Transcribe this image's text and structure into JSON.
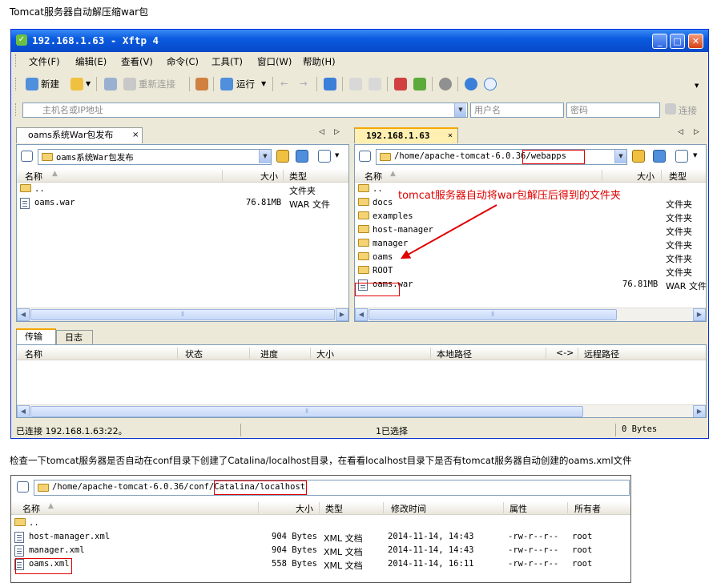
{
  "heading": "Tomcat服务器自动解压缩war包",
  "description": "检查一下tomcat服务器是否自动在conf目录下创建了Catalina/localhost目录，在看看localhost目录下是否有tomcat服务器自动创建的oams.xml文件",
  "window": {
    "title": "192.168.1.63 - Xftp 4",
    "menu": [
      "文件(F)",
      "编辑(E)",
      "查看(V)",
      "命令(C)",
      "工具(T)",
      "窗口(W)",
      "帮助(H)"
    ],
    "toolbar": {
      "new_label": "新建",
      "reconnect_label": "重新连接",
      "run_label": "运行"
    },
    "address": {
      "host_placeholder": "主机名或IP地址",
      "user_placeholder": "用户名",
      "password_placeholder": "密码",
      "connect_label": "连接"
    },
    "left_pane": {
      "tab": "oams系统War包发布",
      "path": "oams系统War包发布",
      "columns": {
        "name": "名称",
        "size": "大小",
        "type": "类型"
      },
      "rows": [
        {
          "name": "..",
          "size": "",
          "type": "文件夹",
          "kind": "folder"
        },
        {
          "name": "oams.war",
          "size": "76.81MB",
          "type": "WAR 文件",
          "kind": "file"
        }
      ]
    },
    "right_pane": {
      "tab": "192.168.1.63",
      "path_prefix": "/home/apache-tomcat-6.0.36/",
      "path_highlight": "webapps",
      "columns": {
        "name": "名称",
        "size": "大小",
        "type": "类型"
      },
      "rows": [
        {
          "name": "..",
          "size": "",
          "type": "",
          "kind": "folder"
        },
        {
          "name": "docs",
          "size": "",
          "type": "文件夹",
          "kind": "folder"
        },
        {
          "name": "examples",
          "size": "",
          "type": "文件夹",
          "kind": "folder"
        },
        {
          "name": "host-manager",
          "size": "",
          "type": "文件夹",
          "kind": "folder"
        },
        {
          "name": "manager",
          "size": "",
          "type": "文件夹",
          "kind": "folder"
        },
        {
          "name": "oams",
          "size": "",
          "type": "文件夹",
          "kind": "folder"
        },
        {
          "name": "ROOT",
          "size": "",
          "type": "文件夹",
          "kind": "folder"
        },
        {
          "name": "oams.war",
          "size": "76.81MB",
          "type": "WAR 文件",
          "kind": "file"
        }
      ],
      "annotation": "tomcat服务器自动将war包解压后得到的文件夹"
    },
    "transfer": {
      "tabs": [
        "传输",
        "日志"
      ],
      "columns": [
        "名称",
        "状态",
        "进度",
        "大小",
        "本地路径",
        "<->",
        "远程路径"
      ]
    },
    "status": {
      "connection": "已连接 192.168.1.63:22。",
      "selection": "1已选择",
      "bytes": "0 Bytes"
    }
  },
  "second_window": {
    "path_prefix": "/home/apache-tomcat-6.0.36/conf/",
    "path_highlight": "Catalina/localhost",
    "columns": {
      "name": "名称",
      "size": "大小",
      "type": "类型",
      "modified": "修改时间",
      "attr": "属性",
      "owner": "所有者"
    },
    "rows": [
      {
        "name": "..",
        "size": "",
        "type": "",
        "modified": "",
        "attr": "",
        "owner": "",
        "kind": "folder"
      },
      {
        "name": "host-manager.xml",
        "size": "904 Bytes",
        "type": "XML 文档",
        "modified": "2014-11-14, 14:43",
        "attr": "-rw-r--r--",
        "owner": "root",
        "kind": "file"
      },
      {
        "name": "manager.xml",
        "size": "904 Bytes",
        "type": "XML 文档",
        "modified": "2014-11-14, 14:43",
        "attr": "-rw-r--r--",
        "owner": "root",
        "kind": "file"
      },
      {
        "name": "oams.xml",
        "size": "558 Bytes",
        "type": "XML 文档",
        "modified": "2014-11-14, 16:11",
        "attr": "-rw-r--r--",
        "owner": "root",
        "kind": "file"
      }
    ]
  },
  "colors": {
    "titlebar": "#0A5BE0",
    "annotation_red": "#E00000",
    "window_bg": "#ECE9D8"
  }
}
